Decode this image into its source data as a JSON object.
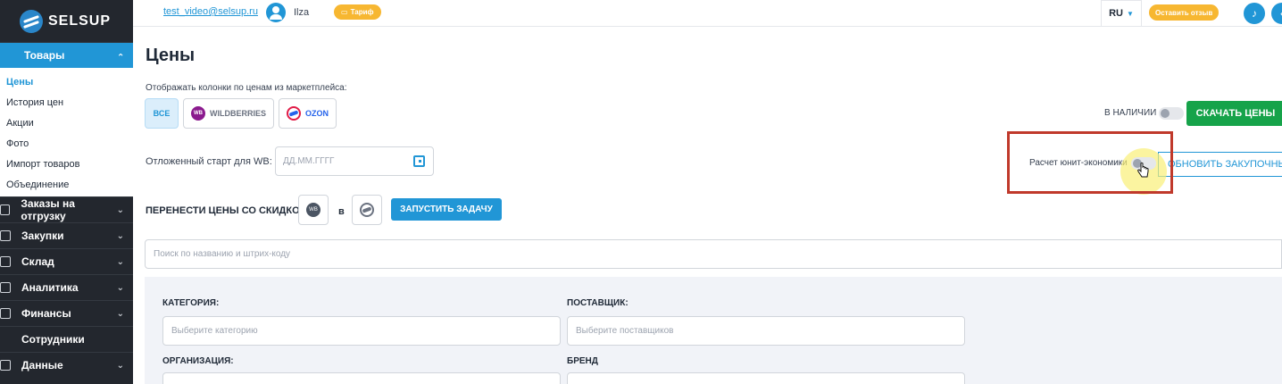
{
  "sidebar": {
    "logo": "SELSUP",
    "active_section": "Товары",
    "sub_items": [
      "Цены",
      "История цен",
      "Акции",
      "Фото",
      "Импорт товаров",
      "Объединение"
    ],
    "items": [
      "Заказы на отгрузку",
      "Закупки",
      "Склад",
      "Аналитика",
      "Финансы",
      "Сотрудники",
      "Данные"
    ]
  },
  "topbar": {
    "email": "test_video@selsup.ru",
    "username": "Ilza",
    "tariff": "Тариф",
    "lang": "RU",
    "review": "Оставить отзыв"
  },
  "main": {
    "title": "Цены",
    "show_columns_label": "Отображать колонки по ценам из маркетплейса:",
    "marketplaces": {
      "all": "ВСЕ",
      "wb": "WILDBERRIES",
      "ozon": "OZON",
      "wb_badge": "WB"
    },
    "stock_label": "В НАЛИЧИИ",
    "download_prices": "СКАЧАТЬ ЦЕНЫ",
    "delayed_start_label": "Отложенный старт для WB:",
    "date_placeholder": "ДД.ММ.ГГГГ",
    "unit_economics_label": "Расчет юнит-экономики",
    "update_purchase": "ОБНОВИТЬ ЗАКУПОЧНЫЕ",
    "transfer_label": "ПЕРЕНЕСТИ ЦЕНЫ СО СКИДКОЙ С",
    "transfer_to": "в",
    "run_task": "ЗАПУСТИТЬ ЗАДАЧУ",
    "search_placeholder": "Поиск по названию и штрих-коду",
    "filters": {
      "category_label": "КАТЕГОРИЯ:",
      "category_placeholder": "Выберите категорию",
      "supplier_label": "ПОСТАВЩИК:",
      "supplier_placeholder": "Выберите поставщиков",
      "org_label": "ОРГАНИЗАЦИЯ:",
      "brand_label": "БРЕНД"
    }
  },
  "colors": {
    "accent": "#2196d6",
    "green": "#16a34a",
    "orange": "#f7b731",
    "sidebar": "#23272e",
    "highlight": "#c0392b"
  }
}
